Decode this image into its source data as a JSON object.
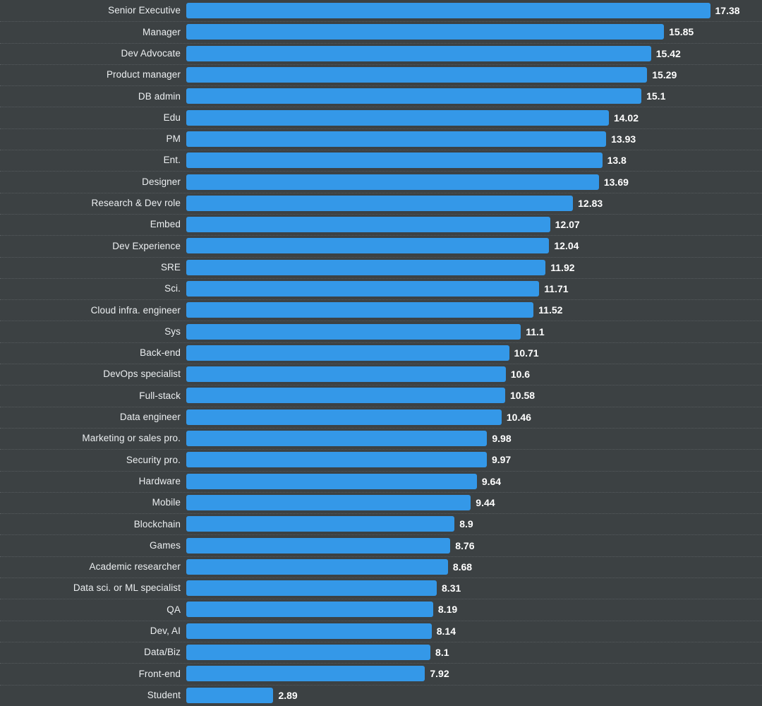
{
  "chart_data": {
    "type": "bar",
    "orientation": "horizontal",
    "title": "",
    "subtitle": "",
    "xlabel": "",
    "ylabel": "",
    "xlim": [
      0,
      19.1
    ],
    "grid": true,
    "legend": null,
    "bar_color": "#3498e8",
    "background_color": "#3c4143",
    "text_color": "#eceff1",
    "gridline_color": "#5b6063",
    "categories": [
      "Senior Executive",
      "Manager",
      "Dev Advocate",
      "Product manager",
      "DB admin",
      "Edu",
      "PM",
      "Ent.",
      "Designer",
      "Research & Dev role",
      "Embed",
      "Dev Experience",
      "SRE",
      "Sci.",
      "Cloud infra. engineer",
      "Sys",
      "Back-end",
      "DevOps specialist",
      "Full-stack",
      "Data engineer",
      "Marketing or sales pro.",
      "Security pro.",
      "Hardware",
      "Mobile",
      "Blockchain",
      "Games",
      "Academic researcher",
      "Data sci. or ML specialist",
      "QA",
      "Dev, AI",
      "Data/Biz",
      "Front-end",
      "Student"
    ],
    "values": [
      17.38,
      15.85,
      15.42,
      15.29,
      15.1,
      14.02,
      13.93,
      13.8,
      13.69,
      12.83,
      12.07,
      12.04,
      11.92,
      11.71,
      11.52,
      11.1,
      10.71,
      10.6,
      10.58,
      10.46,
      9.98,
      9.97,
      9.64,
      9.44,
      8.9,
      8.76,
      8.68,
      8.31,
      8.19,
      8.14,
      8.1,
      7.92,
      2.89
    ],
    "value_labels": [
      "17.38",
      "15.85",
      "15.42",
      "15.29",
      "15.1",
      "14.02",
      "13.93",
      "13.8",
      "13.69",
      "12.83",
      "12.07",
      "12.04",
      "11.92",
      "11.71",
      "11.52",
      "11.1",
      "10.71",
      "10.6",
      "10.58",
      "10.46",
      "9.98",
      "9.97",
      "9.64",
      "9.44",
      "8.9",
      "8.76",
      "8.68",
      "8.31",
      "8.19",
      "8.14",
      "8.1",
      "7.92",
      "2.89"
    ]
  }
}
